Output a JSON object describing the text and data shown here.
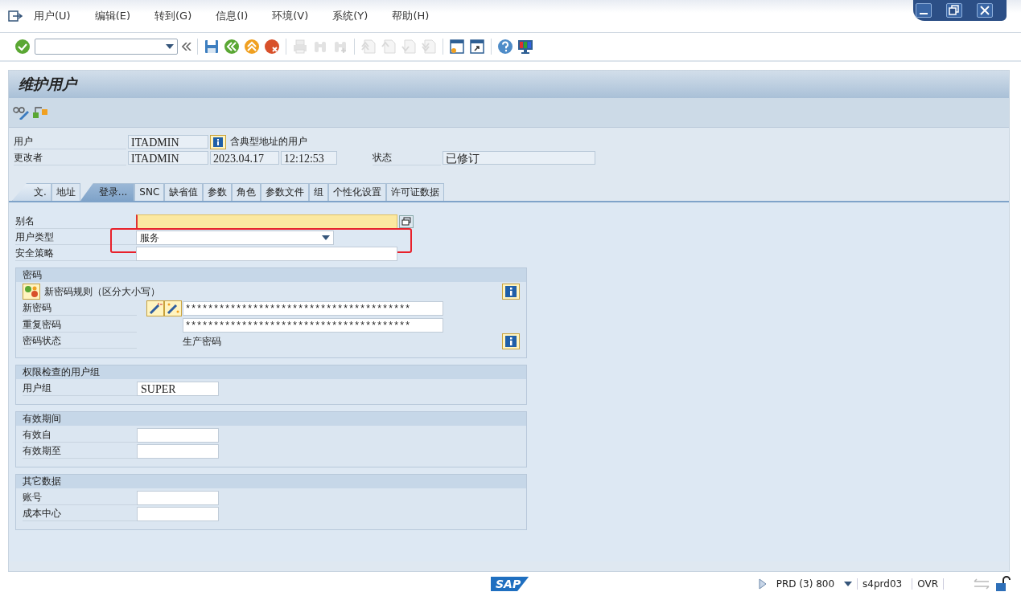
{
  "menu": [
    "用户(U)",
    "编辑(E)",
    "转到(G)",
    "信息(I)",
    "环境(V)",
    "系统(Y)",
    "帮助(H)"
  ],
  "toolbar": {
    "groups": [
      [
        {
          "disabled": false
        }
      ],
      [
        {
          "disabled": false
        },
        {
          "disabled": false
        },
        {
          "disabled": false
        },
        {
          "disabled": false
        }
      ],
      [
        {
          "disabled": true
        },
        {
          "disabled": true
        },
        {
          "disabled": true
        }
      ],
      [
        {
          "disabled": true
        },
        {
          "disabled": true
        },
        {
          "disabled": true
        },
        {
          "disabled": true
        }
      ],
      [
        {
          "disabled": false
        },
        {
          "disabled": false
        }
      ],
      [
        {
          "disabled": false
        },
        {
          "disabled": false
        }
      ]
    ]
  },
  "screen": {
    "title": "维护用户"
  },
  "header": {
    "user_label": "用户",
    "user": "ITADMIN",
    "user_note": "含典型地址的用户",
    "changed_by_label": "更改者",
    "changed_by": "ITADMIN",
    "date": "2023.04.17",
    "time": "12:12:53",
    "status_label": "状态",
    "status": "已修订"
  },
  "tabs": [
    {
      "label": "文.",
      "selected": false
    },
    {
      "label": "地址",
      "selected": false
    },
    {
      "label": "登录...",
      "selected": true
    },
    {
      "label": "SNC",
      "selected": false
    },
    {
      "label": "缺省值",
      "selected": false
    },
    {
      "label": "参数",
      "selected": false
    },
    {
      "label": "角色",
      "selected": false
    },
    {
      "label": "参数文件",
      "selected": false
    },
    {
      "label": "组",
      "selected": false
    },
    {
      "label": "个性化设置",
      "selected": false
    },
    {
      "label": "许可证数据",
      "selected": false
    }
  ],
  "fields": [
    {
      "kind": "required",
      "label": "别名",
      "highlighted": false
    },
    {
      "kind": "dropdown",
      "label": "用户类型",
      "value": "服务",
      "highlighted": true
    },
    {
      "kind": "input",
      "label": "安全策略",
      "highlighted": false
    }
  ],
  "groups": [
    {
      "title": "密码",
      "rows": [
        {
          "kind": "rule",
          "label": "新密码规则（区分大小写）"
        },
        {
          "kind": "password",
          "label": "新密码",
          "value": "****************************************",
          "tools": true
        },
        {
          "kind": "password",
          "label": "重复密码",
          "value": "****************************************",
          "tools": false
        },
        {
          "kind": "text",
          "label": "密码状态",
          "value": "生产密码"
        }
      ]
    },
    {
      "title": "权限检查的用户组",
      "rows": [
        {
          "kind": "field",
          "label": "用户组",
          "value": "SUPER"
        }
      ]
    },
    {
      "title": "有效期间",
      "rows": [
        {
          "kind": "field",
          "label": "有效自"
        },
        {
          "kind": "field",
          "label": "有效期至"
        }
      ]
    },
    {
      "title": "其它数据",
      "rows": [
        {
          "kind": "field",
          "label": "账号"
        },
        {
          "kind": "field",
          "label": "成本中心"
        }
      ]
    }
  ],
  "status_bar": {
    "logo": "SAP",
    "system": "PRD (3) 800",
    "server": "s4prd03",
    "mode": "OVR"
  }
}
